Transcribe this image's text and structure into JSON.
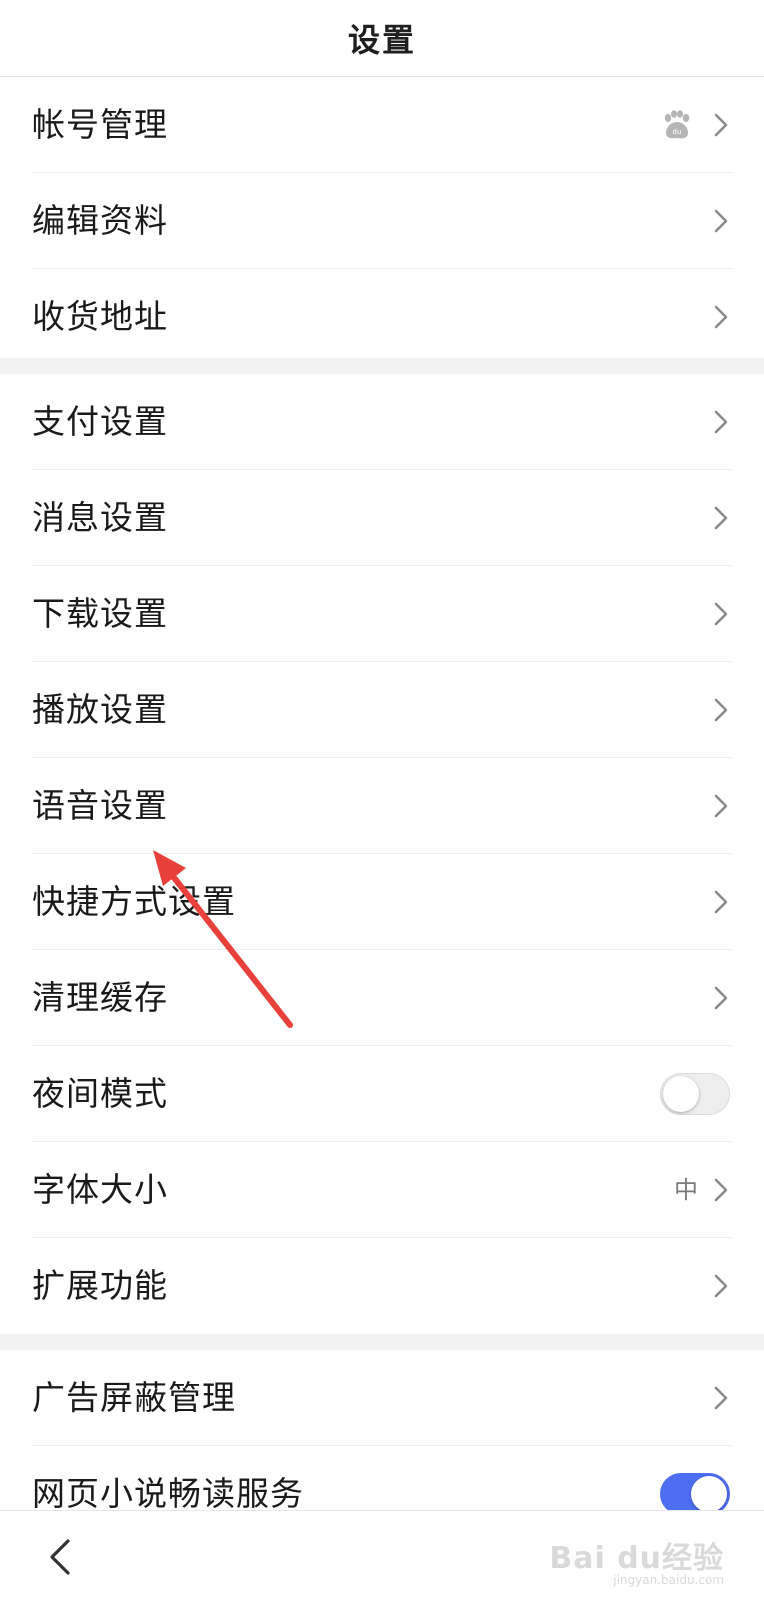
{
  "header": {
    "title": "设置"
  },
  "groups": [
    {
      "items": [
        {
          "label": "帐号管理",
          "icon": "baidu-paw-icon"
        },
        {
          "label": "编辑资料"
        },
        {
          "label": "收货地址"
        }
      ]
    },
    {
      "items": [
        {
          "label": "支付设置"
        },
        {
          "label": "消息设置"
        },
        {
          "label": "下载设置"
        },
        {
          "label": "播放设置"
        },
        {
          "label": "语音设置"
        },
        {
          "label": "快捷方式设置"
        },
        {
          "label": "清理缓存"
        },
        {
          "label": "夜间模式",
          "toggle": false
        },
        {
          "label": "字体大小",
          "value": "中"
        },
        {
          "label": "扩展功能"
        }
      ]
    },
    {
      "items": [
        {
          "label": "广告屏蔽管理"
        },
        {
          "label": "网页小说畅读服务",
          "toggle": true
        }
      ]
    }
  ],
  "watermark": {
    "text": "Bai du经验",
    "sub": "jingyan.baidu.com"
  },
  "colors": {
    "accent": "#4e6ef2",
    "annotation_arrow": "#e8413c"
  }
}
